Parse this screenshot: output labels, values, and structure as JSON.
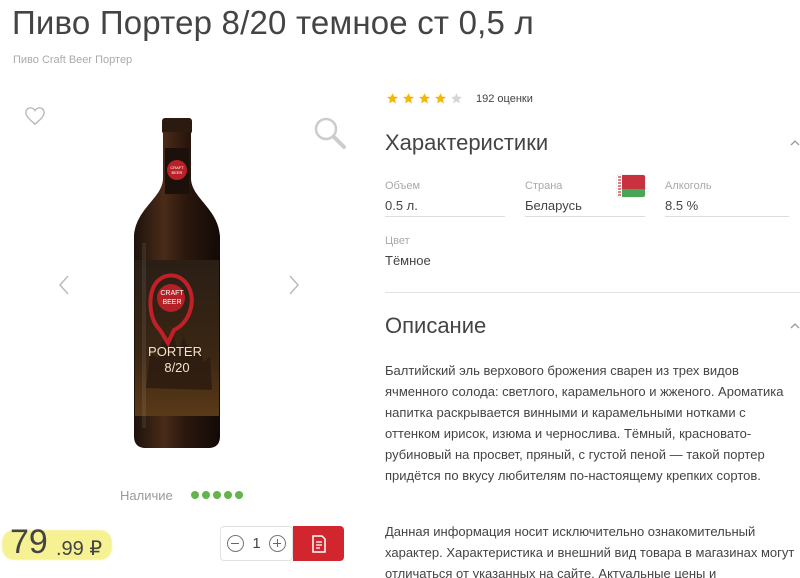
{
  "product": {
    "title": "Пиво Портер 8/20 темное ст 0,5 л",
    "breadcrumb": "Пиво Craft Beer Портер"
  },
  "gallery": {
    "bottle_label_brand_line1": "CRAFT",
    "bottle_label_brand_line2": "BEER",
    "bottle_label_name_line1": "PORTER",
    "bottle_label_name_line2": "8/20"
  },
  "availability": {
    "label": "Наличие",
    "level": 5,
    "max": 5
  },
  "price": {
    "integer": "79",
    "fraction": ".99 ₽"
  },
  "quantity": {
    "value": "1"
  },
  "rating": {
    "stars": 4,
    "max": 5,
    "count_text": "192 оценки"
  },
  "characteristics": {
    "title": "Характеристики",
    "volume_label": "Объем",
    "volume_value": "0.5 л.",
    "country_label": "Страна",
    "country_value": "Беларусь",
    "alcohol_label": "Алкоголь",
    "alcohol_value": "8.5 %",
    "color_label": "Цвет",
    "color_value": "Тёмное"
  },
  "description": {
    "title": "Описание",
    "paragraph1": "Балтийский эль верхового брожения сварен из трех видов ячменного солода: светлого, карамельного и жженого. Ароматика напитка раскрывается винными и карамельными нотками с оттенком ирисок, изюма и чернослива. Тёмный, красновато-рубиновый на просвет, пряный, с густой пеной — такой портер придётся по вкусу любителям по-настоящему крепких сортов.",
    "paragraph2": "Данная информация носит исключительно ознакомительный характер. Характеристика и внешний вид товара в магазинах могут отличаться от указанных на сайте. Актуальные цены и"
  },
  "colors": {
    "accent": "#d2262e",
    "star": "#f5b800",
    "availability": "#62b54b",
    "price_highlight": "#f6f193"
  }
}
